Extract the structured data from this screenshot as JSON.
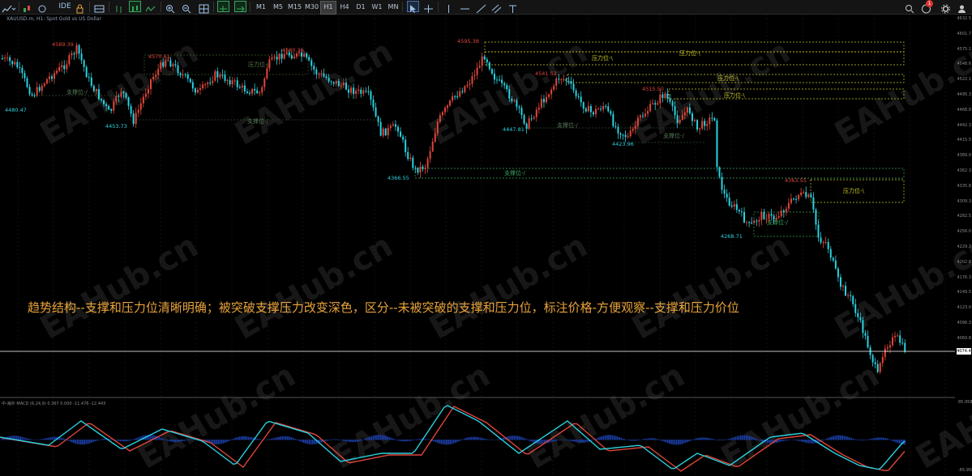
{
  "toolbar": {
    "ide_label": "IDE",
    "timeframes": [
      "M1",
      "M5",
      "M15",
      "M30",
      "H1",
      "H4",
      "D1",
      "W1",
      "MN"
    ],
    "active_timeframe": "H1",
    "notification_count": "1"
  },
  "chart": {
    "title": "XAUUSD.m, H1: Spot Gold vs US Dollar",
    "annotation": "趋势结构--支撑和压力位清晰明确；被突破支撑压力改变深色，区分--未被突破的支撑和压力位，标注价格-方便观察--支撑和压力价位",
    "watermark": "EAHub.cn",
    "current_price": "4074.4",
    "price_labels": [
      "4632.5",
      "4601.7",
      "4575.1",
      "4548.6",
      "4522.1",
      "4495.3",
      "4468.8",
      "4442.3",
      "4415.5",
      "4389.0",
      "4362.3",
      "4335.8",
      "4309.3",
      "4282.5",
      "4256.0",
      "4229.3",
      "4202.8",
      "4176.3",
      "4149.5",
      "4123.0",
      "4096.3",
      "4069.8",
      "4043.3"
    ],
    "highs": [
      "4589.39",
      "4570.61",
      "4580.36",
      "4595.38",
      "4541.52",
      "4515.50",
      "4363.55"
    ],
    "lows": [
      "4480.47",
      "4453.73",
      "4366.55",
      "4447.81",
      "4423.96",
      "4268.71"
    ],
    "resistance_label": "压力位-\\",
    "support_label": "支撑位-/",
    "colors": {
      "bull": "#e0463a",
      "bear": "#2ad2e0",
      "resistance": "#c8c828",
      "support": "#3aa55d",
      "annotation": "#e8a33a"
    }
  },
  "macd": {
    "title": "中-海外 MACD (6,24,9) 0.367 0.000 -11.476 -12.443",
    "axis_labels": [
      "85.958",
      "-85.958"
    ]
  }
}
